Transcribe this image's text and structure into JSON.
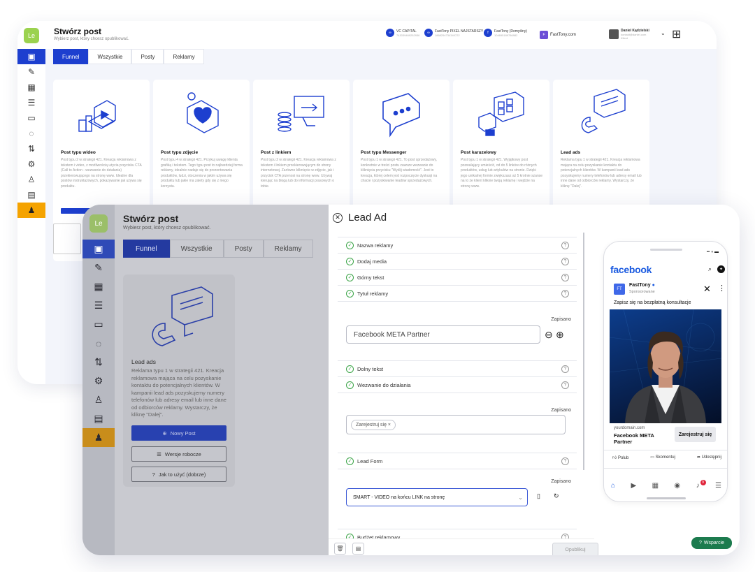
{
  "back": {
    "logo": "Le",
    "title": "Stwórz post",
    "subtitle": "Wybierz post, który chcesz opublikować.",
    "accounts": [
      {
        "name": "VC CAPITAL",
        "id": "743039469252936",
        "icon": "meta-icon"
      },
      {
        "name": "FastTony PIXEL NAJSTARSZY",
        "id": "1868294734340722",
        "icon": "meta-icon"
      },
      {
        "name": "FastTony (Domyślny)",
        "id": "104695189786982",
        "icon": "facebook-icon"
      },
      {
        "name": "FastTony.com",
        "id": "",
        "icon": "page-icon"
      }
    ],
    "user": {
      "name": "Daniel Kądzielski",
      "line2": "kontakt@daniel.com",
      "line3": "Klient"
    },
    "tabs": [
      "Funnel",
      "Wszystkie",
      "Posty",
      "Reklamy"
    ],
    "cards": [
      {
        "title": "Post typu wideo",
        "desc": "Post typu 2 w strategii 421. Kreacja reklamowa z tekstem i video, z możliwością użycia przycisku CTA (Call to Action - wezwanie do działania) przekierowującego na stronę www. Idealne dla postów instruktażowych, pokazywanie jak używa się produktu."
      },
      {
        "title": "Post typu zdjęcie",
        "desc": "Post typu 4 w strategii 421. Przykuj uwagę klienta grafiką i tekstem. Tego typu post to najbardziej forma reklamy, idealnie nadaje się do prezentowania produktów, ludzi, otoczenia w jakim używa się produktu lub jakie ma zalety gdy się z niego korzysta."
      },
      {
        "title": "Post z linkiem",
        "desc": "Post typu 2 w strategii 421. Kreacja reklamowa z tekstem i linkiem przekierowującym do strony internetowej. Zarówno kliknięcie w zdjęcie, jak i przycisk CTA przenosi na stronę www. Używaj kierując na blogą lub do informacji prasowych o tobie."
      },
      {
        "title": "Post typu Messenger",
        "desc": "Post typu 1 w strategii 421. To post sprzedażowy, konkretnie w treści postu zawsze wezwanie do kliknięcia przycisku \"Wyślij wiadomość\". Jest to kreacja, której celem jest rozpoczęcie dyskusji na chacie i pozyskiwanie leadów sprzedażowych."
      },
      {
        "title": "Post karuzelowy",
        "desc": "Post typu 1 w strategii 421. Wyjątkowy post pozwalający umieścić, od do 5 linków do różnych produktów, usług lub artykułów na stronie. Dzięki jego unikalnej formie zwiększasz aż 5 krotnie szanse na to że klient kliknie twoją reklamę i wejdzie na stronę www."
      },
      {
        "title": "Lead ads",
        "desc": "Reklama typu 1 w strategii 421. Kreacja reklamowa mająca na celu pozyskanie kontaktu do potencjalnych klientów. W kampanii lead ads pozyskujemy numery telefonów lub adresy email lub inne dane od odbiorców reklamy. Wystarczy, że kliknę \"Dalej\"."
      }
    ]
  },
  "front": {
    "logo": "Le",
    "title": "Stwórz post",
    "subtitle": "Wybierz post, który chcesz opublikować.",
    "tabs": [
      "Funnel",
      "Wszystkie",
      "Posty",
      "Reklamy"
    ],
    "card": {
      "title": "Lead ads",
      "desc": "Reklama typu 1 w strategii 421. Kreacja reklamowa mająca na celu pozyskanie kontaktu do potencjalnych klientów. W kampanii lead ads pozyskujemy numery telefonów lub adresy email lub inne dane od odbiorców reklamy. Wystarczy, że kliknę \"Dalej\".",
      "btn_new": "Nowy Post",
      "btn_drafts": "Wersje robocze",
      "btn_howto": "Jak to użyć (dobrze)"
    }
  },
  "lead_ad": {
    "title": "Lead Ad",
    "rows": {
      "nazwa": "Nazwa reklamy",
      "media": "Dodaj media",
      "gorny": "Górny tekst",
      "tytul": "Tytuł reklamy",
      "dolny": "Dolny tekst",
      "wezwanie": "Wezwanie do działania",
      "leadform": "Lead Form",
      "budzet": "Budżet reklamowy"
    },
    "saved": "Zapisano",
    "title_value": "Facebook META Partner",
    "cta_chip": "Zarejestruj się",
    "leadform_value": "SMART - VIDEO na końcu LINK na stronę",
    "publish": "Opublikuj"
  },
  "preview": {
    "brand": "facebook",
    "page_name": "FastTony",
    "sponsored": "Sponsorowane",
    "text": "Zapisz się na bezpłatną konsultacje",
    "domain": "yourdomain.com",
    "ad_title": "Facebook META Partner",
    "cta": "Zarejestruj się",
    "like": "Polub",
    "comment": "Skomentuj",
    "share": "Udostępnij",
    "notif_count": "9"
  },
  "support": "Wsparcie",
  "colors": {
    "primary": "#1d3fcf",
    "accent": "#f5a300",
    "success": "#3ba447",
    "support": "#1c7b4e",
    "facebook": "#1a5ae0"
  }
}
